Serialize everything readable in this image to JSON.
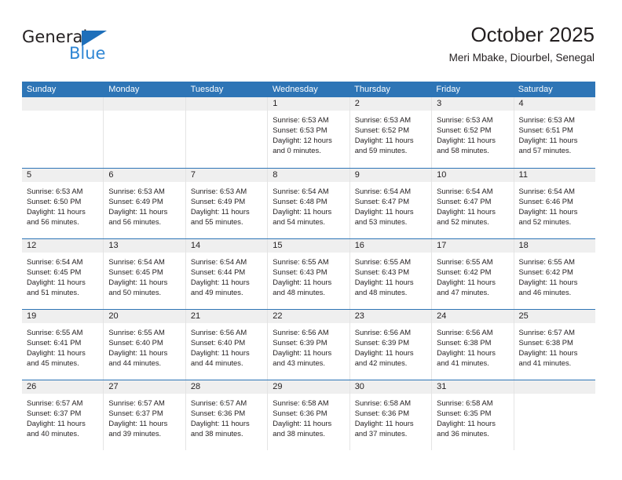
{
  "brand": {
    "word_top": "General",
    "word_bottom": "Blue",
    "triangle_color": "#1e6fba",
    "blue_text_color": "#2f86d4"
  },
  "header": {
    "title": "October 2025",
    "subtitle": "Meri Mbake, Diourbel, Senegal"
  },
  "theme": {
    "header_blue": "#2e75b6",
    "day_band_gray": "#efefef",
    "text": "#231f20"
  },
  "weekdays": [
    "Sunday",
    "Monday",
    "Tuesday",
    "Wednesday",
    "Thursday",
    "Friday",
    "Saturday"
  ],
  "weeks": [
    [
      {
        "day": "",
        "sunrise": "",
        "sunset": "",
        "daylight1": "",
        "daylight2": "",
        "empty": true
      },
      {
        "day": "",
        "sunrise": "",
        "sunset": "",
        "daylight1": "",
        "daylight2": "",
        "empty": true
      },
      {
        "day": "",
        "sunrise": "",
        "sunset": "",
        "daylight1": "",
        "daylight2": "",
        "empty": true
      },
      {
        "day": "1",
        "sunrise": "Sunrise: 6:53 AM",
        "sunset": "Sunset: 6:53 PM",
        "daylight1": "Daylight: 12 hours",
        "daylight2": "and 0 minutes."
      },
      {
        "day": "2",
        "sunrise": "Sunrise: 6:53 AM",
        "sunset": "Sunset: 6:52 PM",
        "daylight1": "Daylight: 11 hours",
        "daylight2": "and 59 minutes."
      },
      {
        "day": "3",
        "sunrise": "Sunrise: 6:53 AM",
        "sunset": "Sunset: 6:52 PM",
        "daylight1": "Daylight: 11 hours",
        "daylight2": "and 58 minutes."
      },
      {
        "day": "4",
        "sunrise": "Sunrise: 6:53 AM",
        "sunset": "Sunset: 6:51 PM",
        "daylight1": "Daylight: 11 hours",
        "daylight2": "and 57 minutes."
      }
    ],
    [
      {
        "day": "5",
        "sunrise": "Sunrise: 6:53 AM",
        "sunset": "Sunset: 6:50 PM",
        "daylight1": "Daylight: 11 hours",
        "daylight2": "and 56 minutes."
      },
      {
        "day": "6",
        "sunrise": "Sunrise: 6:53 AM",
        "sunset": "Sunset: 6:49 PM",
        "daylight1": "Daylight: 11 hours",
        "daylight2": "and 56 minutes."
      },
      {
        "day": "7",
        "sunrise": "Sunrise: 6:53 AM",
        "sunset": "Sunset: 6:49 PM",
        "daylight1": "Daylight: 11 hours",
        "daylight2": "and 55 minutes."
      },
      {
        "day": "8",
        "sunrise": "Sunrise: 6:54 AM",
        "sunset": "Sunset: 6:48 PM",
        "daylight1": "Daylight: 11 hours",
        "daylight2": "and 54 minutes."
      },
      {
        "day": "9",
        "sunrise": "Sunrise: 6:54 AM",
        "sunset": "Sunset: 6:47 PM",
        "daylight1": "Daylight: 11 hours",
        "daylight2": "and 53 minutes."
      },
      {
        "day": "10",
        "sunrise": "Sunrise: 6:54 AM",
        "sunset": "Sunset: 6:47 PM",
        "daylight1": "Daylight: 11 hours",
        "daylight2": "and 52 minutes."
      },
      {
        "day": "11",
        "sunrise": "Sunrise: 6:54 AM",
        "sunset": "Sunset: 6:46 PM",
        "daylight1": "Daylight: 11 hours",
        "daylight2": "and 52 minutes."
      }
    ],
    [
      {
        "day": "12",
        "sunrise": "Sunrise: 6:54 AM",
        "sunset": "Sunset: 6:45 PM",
        "daylight1": "Daylight: 11 hours",
        "daylight2": "and 51 minutes."
      },
      {
        "day": "13",
        "sunrise": "Sunrise: 6:54 AM",
        "sunset": "Sunset: 6:45 PM",
        "daylight1": "Daylight: 11 hours",
        "daylight2": "and 50 minutes."
      },
      {
        "day": "14",
        "sunrise": "Sunrise: 6:54 AM",
        "sunset": "Sunset: 6:44 PM",
        "daylight1": "Daylight: 11 hours",
        "daylight2": "and 49 minutes."
      },
      {
        "day": "15",
        "sunrise": "Sunrise: 6:55 AM",
        "sunset": "Sunset: 6:43 PM",
        "daylight1": "Daylight: 11 hours",
        "daylight2": "and 48 minutes."
      },
      {
        "day": "16",
        "sunrise": "Sunrise: 6:55 AM",
        "sunset": "Sunset: 6:43 PM",
        "daylight1": "Daylight: 11 hours",
        "daylight2": "and 48 minutes."
      },
      {
        "day": "17",
        "sunrise": "Sunrise: 6:55 AM",
        "sunset": "Sunset: 6:42 PM",
        "daylight1": "Daylight: 11 hours",
        "daylight2": "and 47 minutes."
      },
      {
        "day": "18",
        "sunrise": "Sunrise: 6:55 AM",
        "sunset": "Sunset: 6:42 PM",
        "daylight1": "Daylight: 11 hours",
        "daylight2": "and 46 minutes."
      }
    ],
    [
      {
        "day": "19",
        "sunrise": "Sunrise: 6:55 AM",
        "sunset": "Sunset: 6:41 PM",
        "daylight1": "Daylight: 11 hours",
        "daylight2": "and 45 minutes."
      },
      {
        "day": "20",
        "sunrise": "Sunrise: 6:55 AM",
        "sunset": "Sunset: 6:40 PM",
        "daylight1": "Daylight: 11 hours",
        "daylight2": "and 44 minutes."
      },
      {
        "day": "21",
        "sunrise": "Sunrise: 6:56 AM",
        "sunset": "Sunset: 6:40 PM",
        "daylight1": "Daylight: 11 hours",
        "daylight2": "and 44 minutes."
      },
      {
        "day": "22",
        "sunrise": "Sunrise: 6:56 AM",
        "sunset": "Sunset: 6:39 PM",
        "daylight1": "Daylight: 11 hours",
        "daylight2": "and 43 minutes."
      },
      {
        "day": "23",
        "sunrise": "Sunrise: 6:56 AM",
        "sunset": "Sunset: 6:39 PM",
        "daylight1": "Daylight: 11 hours",
        "daylight2": "and 42 minutes."
      },
      {
        "day": "24",
        "sunrise": "Sunrise: 6:56 AM",
        "sunset": "Sunset: 6:38 PM",
        "daylight1": "Daylight: 11 hours",
        "daylight2": "and 41 minutes."
      },
      {
        "day": "25",
        "sunrise": "Sunrise: 6:57 AM",
        "sunset": "Sunset: 6:38 PM",
        "daylight1": "Daylight: 11 hours",
        "daylight2": "and 41 minutes."
      }
    ],
    [
      {
        "day": "26",
        "sunrise": "Sunrise: 6:57 AM",
        "sunset": "Sunset: 6:37 PM",
        "daylight1": "Daylight: 11 hours",
        "daylight2": "and 40 minutes."
      },
      {
        "day": "27",
        "sunrise": "Sunrise: 6:57 AM",
        "sunset": "Sunset: 6:37 PM",
        "daylight1": "Daylight: 11 hours",
        "daylight2": "and 39 minutes."
      },
      {
        "day": "28",
        "sunrise": "Sunrise: 6:57 AM",
        "sunset": "Sunset: 6:36 PM",
        "daylight1": "Daylight: 11 hours",
        "daylight2": "and 38 minutes."
      },
      {
        "day": "29",
        "sunrise": "Sunrise: 6:58 AM",
        "sunset": "Sunset: 6:36 PM",
        "daylight1": "Daylight: 11 hours",
        "daylight2": "and 38 minutes."
      },
      {
        "day": "30",
        "sunrise": "Sunrise: 6:58 AM",
        "sunset": "Sunset: 6:36 PM",
        "daylight1": "Daylight: 11 hours",
        "daylight2": "and 37 minutes."
      },
      {
        "day": "31",
        "sunrise": "Sunrise: 6:58 AM",
        "sunset": "Sunset: 6:35 PM",
        "daylight1": "Daylight: 11 hours",
        "daylight2": "and 36 minutes."
      },
      {
        "day": "",
        "sunrise": "",
        "sunset": "",
        "daylight1": "",
        "daylight2": "",
        "empty": true
      }
    ]
  ]
}
